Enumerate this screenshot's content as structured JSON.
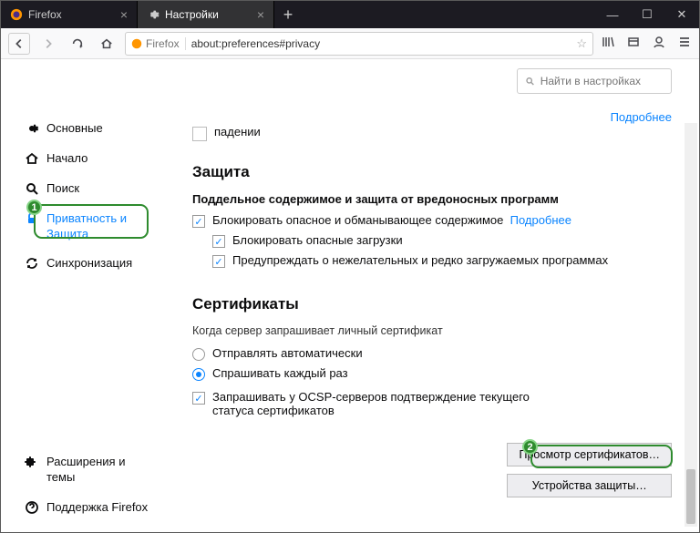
{
  "tabs": [
    {
      "label": "Firefox"
    },
    {
      "label": "Настройки"
    }
  ],
  "identity_label": "Firefox",
  "url": "about:preferences#privacy",
  "search_placeholder": "Найти в настройках",
  "sidebar": [
    {
      "label": "Основные"
    },
    {
      "label": "Начало"
    },
    {
      "label": "Поиск"
    },
    {
      "label": "Приватность и Защита"
    },
    {
      "label": "Синхронизация"
    }
  ],
  "sidebar_bottom": [
    {
      "label": "Расширения и темы"
    },
    {
      "label": "Поддержка Firefox"
    }
  ],
  "clipped_text": "падении",
  "more_label": "Подробнее",
  "section_protection": "Защита",
  "sub_deceptive": "Поддельное содержимое и защита от вредоносных программ",
  "chk_block_dangerous": "Блокировать опасное и обманывающее содержимое",
  "chk_block_downloads": "Блокировать опасные загрузки",
  "chk_warn_unwanted": "Предупреждать о нежелательных и редко загружаемых программах",
  "section_certs": "Сертификаты",
  "desc_certs": "Когда сервер запрашивает личный сертификат",
  "radio_auto": "Отправлять автоматически",
  "radio_ask": "Спрашивать каждый раз",
  "chk_ocsp": "Запрашивать у OCSP-серверов подтверждение текущего статуса сертификатов",
  "btn_view_certs": "Просмотр сертификатов…",
  "btn_devices": "Устройства защиты…"
}
